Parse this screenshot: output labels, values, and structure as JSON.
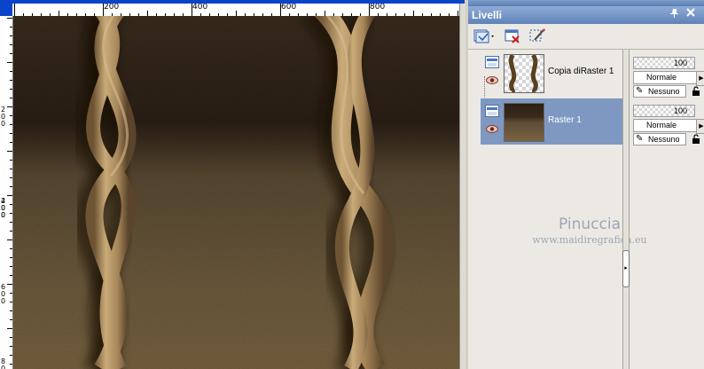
{
  "ruler": {
    "top_labels": [
      "0",
      "200",
      "400",
      "600",
      "800"
    ],
    "left_labels": [
      "2",
      "0",
      "0",
      "2",
      "0",
      "0",
      "4",
      "0",
      "0",
      "6",
      "0",
      "0",
      "8",
      "0"
    ]
  },
  "panel": {
    "title": "Livelli",
    "pin_icon": "pin-icon",
    "close_icon": "close-icon"
  },
  "layers": [
    {
      "name": "Copia diRaster 1",
      "opacity": "100",
      "blend": "Normale",
      "mask": "Nessuno",
      "selected": false
    },
    {
      "name": "Raster 1",
      "opacity": "100",
      "blend": "Normale",
      "mask": "Nessuno",
      "selected": true
    }
  ],
  "watermark": {
    "name": "Pinuccia",
    "url": "www.maidiregrafica.eu"
  },
  "colors": {
    "titlebar": "#5e82b8",
    "selected_row": "#7f98c2",
    "canvas_dark": "#2a1f14",
    "canvas_light": "#7a6440",
    "tape": "#b4966a"
  }
}
